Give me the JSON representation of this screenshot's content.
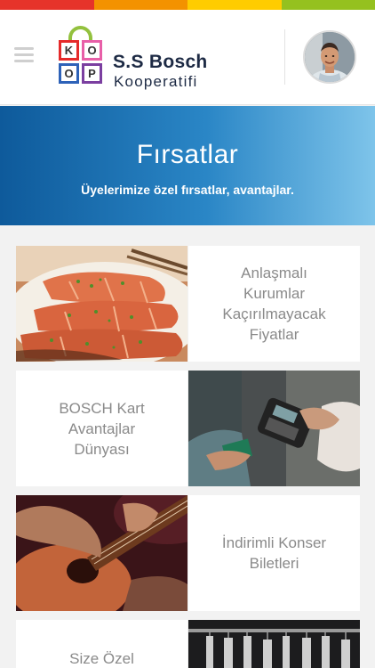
{
  "brand": {
    "strip_colors": [
      "#e6332a",
      "#f39200",
      "#ffcc00",
      "#95c11f"
    ],
    "logo_letters": [
      "K",
      "O",
      "O",
      "P"
    ],
    "name": "S.S Bosch",
    "subname": "Kooperatifi"
  },
  "header": {
    "menu_icon": "hamburger-icon",
    "avatar_icon": "user-avatar"
  },
  "banner": {
    "title": "Fırsatlar",
    "subtitle": "Üyelerimize özel fırsatlar, avantajlar."
  },
  "tiles": [
    {
      "label": "Anlaşmalı Kurumlar Kaçırılmayacak Fiyatlar",
      "image": "salmon-dish-photo"
    },
    {
      "label": "BOSCH Kart Avantajlar Dünyası",
      "image": "card-payment-photo"
    },
    {
      "label": "İndirimli Konser Biletleri",
      "image": "guitar-player-photo"
    },
    {
      "label": "Size Özel Fiyatlarla",
      "image": "clothing-rack-photo"
    }
  ]
}
